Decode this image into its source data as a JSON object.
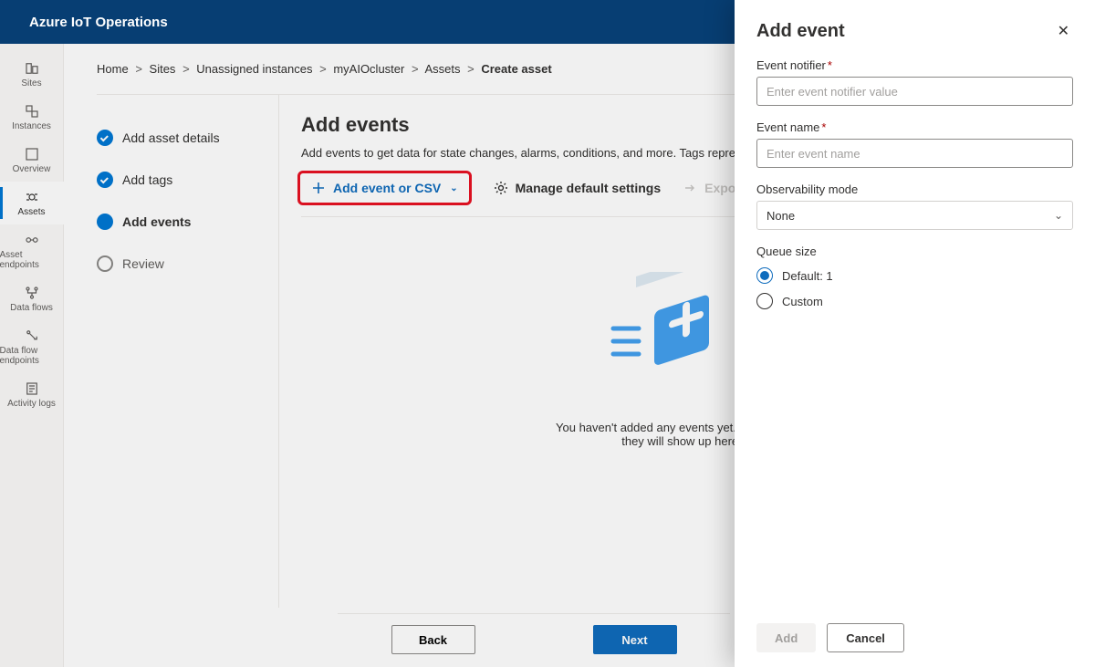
{
  "header": {
    "title": "Azure IoT Operations"
  },
  "nav": {
    "items": [
      {
        "label": "Sites"
      },
      {
        "label": "Instances"
      },
      {
        "label": "Overview"
      },
      {
        "label": "Assets"
      },
      {
        "label": "Asset endpoints"
      },
      {
        "label": "Data flows"
      },
      {
        "label": "Data flow endpoints"
      },
      {
        "label": "Activity logs"
      }
    ]
  },
  "breadcrumb": {
    "items": [
      "Home",
      "Sites",
      "Unassigned instances",
      "myAIOcluster",
      "Assets"
    ],
    "current": "Create asset"
  },
  "wizard": {
    "steps": [
      {
        "label": "Add asset details"
      },
      {
        "label": "Add tags"
      },
      {
        "label": "Add events"
      },
      {
        "label": "Review"
      }
    ]
  },
  "detail": {
    "title": "Add events",
    "subtext": "Add events to get data for state changes, alarms, conditions, and more. Tags represent actions related to the state of the asset.",
    "toolbar": {
      "addEvent": "Add event or CSV",
      "manageDefault": "Manage default settings",
      "export": "Export all"
    },
    "emptyState": {
      "line1": "You haven't added any events yet. Once added,",
      "line2": "they will show up here."
    },
    "footer": {
      "back": "Back",
      "next": "Next"
    }
  },
  "flyout": {
    "title": "Add event",
    "fields": {
      "notifier": {
        "label": "Event notifier",
        "placeholder": "Enter event notifier value"
      },
      "name": {
        "label": "Event name",
        "placeholder": "Enter event name"
      },
      "obsMode": {
        "label": "Observability mode",
        "value": "None"
      },
      "queue": {
        "label": "Queue size",
        "optDefault": "Default: 1",
        "optCustom": "Custom"
      }
    },
    "buttons": {
      "add": "Add",
      "cancel": "Cancel"
    }
  }
}
